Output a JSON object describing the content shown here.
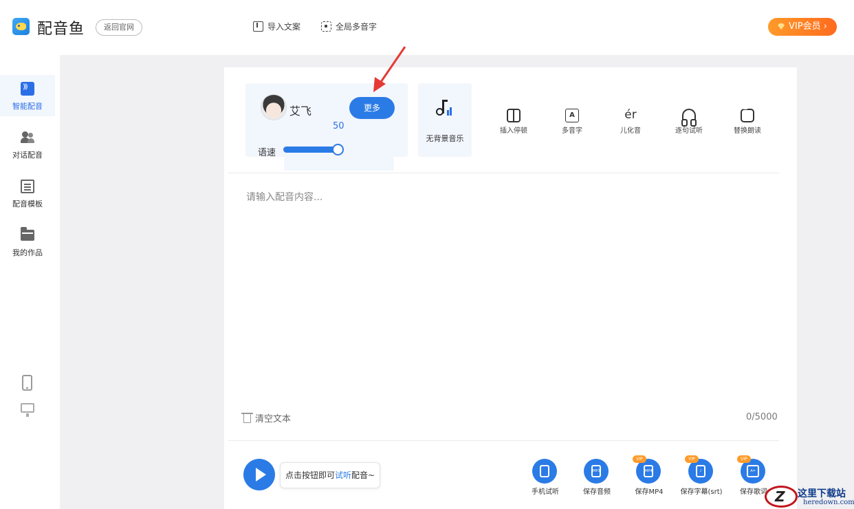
{
  "header": {
    "app_name": "配音鱼",
    "back_label": "返回官网",
    "import_label": "导入文案",
    "polyphone_label": "全局多音字",
    "vip_label": "VIP会员 ›"
  },
  "sidebar": {
    "items": [
      {
        "label": "智能配音",
        "icon": "voice-icon",
        "active": true
      },
      {
        "label": "对话配音",
        "icon": "people-icon",
        "active": false
      },
      {
        "label": "配音模板",
        "icon": "document-icon",
        "active": false
      },
      {
        "label": "我的作品",
        "icon": "folder-icon",
        "active": false
      }
    ]
  },
  "voice": {
    "name": "艾飞",
    "more_label": "更多",
    "speed_label": "语速",
    "speed_value": "50",
    "speed_fraction": 0.93
  },
  "bgm": {
    "label": "无背景音乐",
    "icon": "music-note-icon"
  },
  "tools": [
    {
      "label": "插入停顿",
      "icon": "pause-icon"
    },
    {
      "label": "多音字",
      "icon": "polyphone-icon",
      "glyph": "A"
    },
    {
      "label": "儿化音",
      "icon": "er-icon",
      "glyph": "ér"
    },
    {
      "label": "逐句试听",
      "icon": "headphone-icon"
    },
    {
      "label": "替换朗读",
      "icon": "swap-icon"
    }
  ],
  "editor": {
    "placeholder": "请输入配音内容...",
    "clear_label": "清空文本",
    "counter": "0/5000"
  },
  "player": {
    "hint_prefix": "点击按钮即可",
    "hint_highlight": "试听",
    "hint_suffix": "配音~"
  },
  "save_options": [
    {
      "label": "手机试听",
      "icon": "phone-icon",
      "vip": false,
      "glyph": ""
    },
    {
      "label": "保存音频",
      "icon": "mp3-file-icon",
      "vip": false,
      "glyph": "MP3"
    },
    {
      "label": "保存MP4",
      "icon": "mp4-file-icon",
      "vip": true,
      "glyph": "MP4"
    },
    {
      "label": "保存字幕(srt)",
      "icon": "subtitle-file-icon",
      "vip": true,
      "glyph": "♪"
    },
    {
      "label": "保存歌词",
      "icon": "lyrics-icon",
      "vip": true,
      "glyph": "A="
    }
  ],
  "vip_tag": "VIP",
  "watermark": {
    "cn": "这里下载站",
    "en": "heredown.com"
  },
  "colors": {
    "accent": "#2b7be6",
    "vip": "#ff7a22",
    "panel_bg": "#f2f6fd",
    "annotation": "#e53935"
  }
}
